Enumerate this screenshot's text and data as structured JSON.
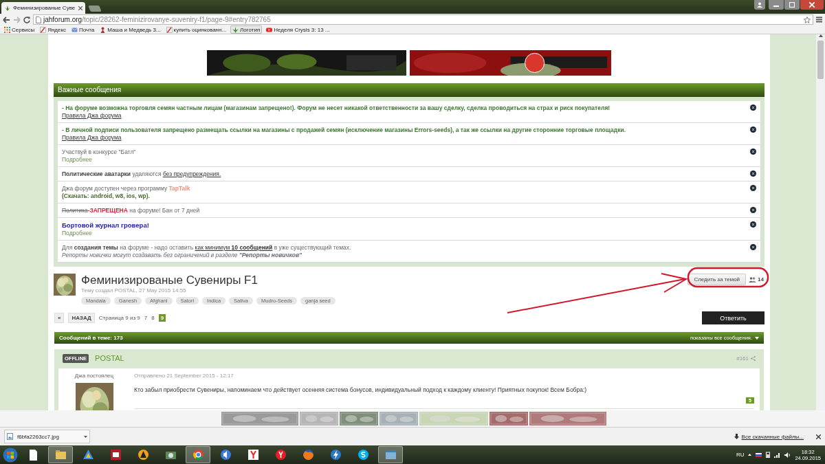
{
  "browser": {
    "tab": {
      "title": "Феминизированые Суве"
    },
    "url": {
      "host": "jahforum.org",
      "path": "/topic/28262-feminizirovanye-suveniry-f1/page-9#entry782765"
    },
    "bookmarks": [
      {
        "label": "Сервисы",
        "kind": "apps",
        "selected": false
      },
      {
        "label": "Яндекс",
        "kind": "page",
        "selected": false
      },
      {
        "label": "Почта",
        "kind": "mail",
        "selected": false
      },
      {
        "label": "Маша и Медведь 3...",
        "kind": "figure",
        "selected": false
      },
      {
        "label": "купить оцинкованн...",
        "kind": "page",
        "selected": false
      },
      {
        "label": "Логотип",
        "kind": "leaf",
        "selected": true
      },
      {
        "label": "Неделя Crysis 3: 13 ...",
        "kind": "video",
        "selected": false
      }
    ]
  },
  "notices": {
    "title": "Важные сообщения",
    "items": [
      {
        "lines": [
          [
            {
              "kind": "alert",
              "text": "- На форуме возможна торговля семян частным лицам (магазинам запрещено!). Форум не несет никакой ответственности за вашу сделку, сделка проводиться на страх и риск покупателя!"
            }
          ],
          [
            {
              "kind": "link",
              "text": "Правила Джа форума"
            }
          ]
        ]
      },
      {
        "lines": [
          [
            {
              "kind": "alert",
              "text": "- В личной подписи пользователя запрещено размещать ссылки на магазины с продажей семян (исключение магазины Errors-seeds), а так же ссылки на другие сторонние торговые площадки."
            }
          ],
          [
            {
              "kind": "link",
              "text": "Правила Джа форума"
            }
          ]
        ]
      },
      {
        "lines": [
          [
            {
              "kind": "normal",
              "text": "Участвуй в конкурсе \"Батл\""
            }
          ],
          [
            {
              "kind": "more",
              "text": "Подробнее"
            }
          ]
        ]
      },
      {
        "lines": [
          [
            {
              "kind": "bold",
              "text": "Политические аватарки"
            },
            {
              "kind": "normal",
              "text": " удаляются "
            },
            {
              "kind": "link",
              "text": "без предупреждения."
            }
          ]
        ]
      },
      {
        "lines": [
          [
            {
              "kind": "normal",
              "text": "Джа форум доступен через программу "
            },
            {
              "kind": "accent",
              "text": "TapTalk"
            }
          ],
          [
            {
              "kind": "olive",
              "text": "(Скачать: android, w8, ios, wp)."
            }
          ]
        ]
      },
      {
        "lines": [
          [
            {
              "kind": "strike",
              "text": "Политика"
            },
            {
              "kind": "danger",
              "text": "-ЗАПРЕЩЕНА"
            },
            {
              "kind": "normal",
              "text": " на форуме! Бан от 7 дней"
            }
          ]
        ]
      },
      {
        "lines": [
          [
            {
              "kind": "blue",
              "text": "Бортовой журнал гровера!"
            }
          ],
          [
            {
              "kind": "more",
              "text": "Подробнее"
            }
          ]
        ]
      },
      {
        "lines": [
          [
            {
              "kind": "normal",
              "text": "Для "
            },
            {
              "kind": "bold",
              "text": "создания темы"
            },
            {
              "kind": "normal",
              "text": " на форуме - надо оставить "
            },
            {
              "kind": "link",
              "text": "как минимум **10 сообщений**"
            },
            {
              "kind": "normal",
              "text": " в уже существующий темах."
            }
          ],
          [
            {
              "kind": "italic",
              "text": "Репорты новички могут создавать без ограничений в разделе **\"Репорты новичков\"**"
            }
          ]
        ]
      }
    ]
  },
  "topic": {
    "title": "Феминизированые Сувениры F1",
    "meta": "Тему создал POSTAL, 27 May 2015 14:55",
    "tags": [
      "Mandala",
      "Ganesh",
      "Afghani",
      "Satori",
      "Indica",
      "Sativa",
      "Mudro-Seeds",
      "ganja seed"
    ],
    "follow": "Следить за темой",
    "followers": "14"
  },
  "pagination": {
    "first": "«",
    "back": "НАЗАД",
    "summary": "Страница 9 из 9",
    "pages": [
      {
        "label": "7",
        "selected": false
      },
      {
        "label": "8",
        "selected": false
      },
      {
        "label": "9",
        "selected": true
      }
    ],
    "reply": "Ответить"
  },
  "posts_bar": {
    "count": "Сообщений в теме: 173",
    "filter": "показаны все сообщения."
  },
  "post": {
    "status": "OFFLINE",
    "author": "POSTAL",
    "number": "#161",
    "rank": "Джа постоялец",
    "date": "Отправлено 21 September 2015 - 12:17",
    "text": "Кто забыл приобрести Сувениры, напоминаем что действует осенняя система бонусов, индивидуальный подход к каждому клиенту! Приятных покупок! Всем Бобра:)",
    "reputation": "5"
  },
  "download": {
    "file": "f6bfa2263cc7.jpg",
    "all": "Все скачанные файлы..."
  },
  "taskbar": {
    "apps": [
      {
        "kind": "file",
        "selected": false
      },
      {
        "kind": "folder",
        "selected": true
      },
      {
        "kind": "drive",
        "selected": false
      },
      {
        "kind": "media",
        "selected": false
      },
      {
        "kind": "player",
        "selected": false
      },
      {
        "kind": "camera",
        "selected": false
      },
      {
        "kind": "chrome",
        "selected": true
      },
      {
        "kind": "speaker",
        "selected": false
      },
      {
        "kind": "yandex",
        "selected": false
      },
      {
        "kind": "ybrowser",
        "selected": false
      },
      {
        "kind": "firefox",
        "selected": false
      },
      {
        "kind": "bolt",
        "selected": false
      },
      {
        "kind": "skype",
        "selected": false
      },
      {
        "kind": "window",
        "selected": true
      }
    ],
    "language": "RU",
    "time": "18:32",
    "date": "24.09.2015"
  },
  "annotation": {
    "circled": true,
    "arrow": true
  }
}
